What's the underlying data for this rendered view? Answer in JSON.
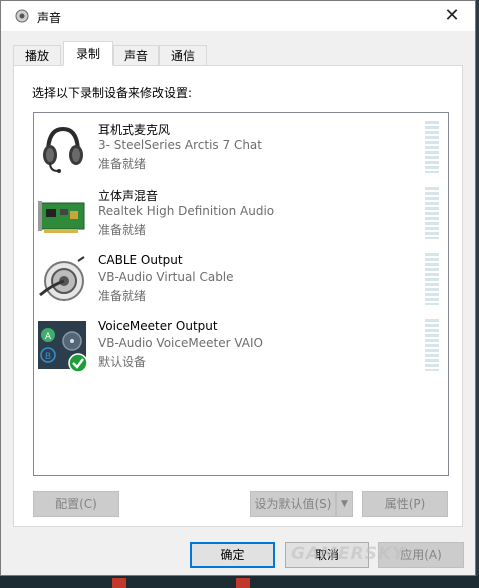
{
  "window": {
    "title": "声音",
    "close_glyph": "✕"
  },
  "tabs": [
    {
      "label": "播放",
      "active": false
    },
    {
      "label": "录制",
      "active": true
    },
    {
      "label": "声音",
      "active": false
    },
    {
      "label": "通信",
      "active": false
    }
  ],
  "instruction": "选择以下录制设备来修改设置:",
  "devices": [
    {
      "name": "耳机式麦克风",
      "description": "3- SteelSeries Arctis 7 Chat",
      "status": "准备就绪",
      "icon": "headset-icon"
    },
    {
      "name": "立体声混音",
      "description": "Realtek High Definition Audio",
      "status": "准备就绪",
      "icon": "sound-card-icon"
    },
    {
      "name": "CABLE Output",
      "description": "VB-Audio Virtual Cable",
      "status": "准备就绪",
      "icon": "cable-icon"
    },
    {
      "name": "VoiceMeeter Output",
      "description": "VB-Audio VoiceMeeter VAIO",
      "status": "默认设备",
      "icon": "voicemeeter-icon",
      "default": true
    }
  ],
  "buttons": {
    "configure": "配置(C)",
    "set_default": "设为默认值(S)",
    "properties": "属性(P)",
    "ok": "确定",
    "cancel": "取消",
    "apply": "应用(A)"
  },
  "watermark": "GAMERSKY",
  "colors": {
    "accent": "#0078d7",
    "default_check": "#1e9e3a",
    "meter": "#d6e4ec"
  }
}
